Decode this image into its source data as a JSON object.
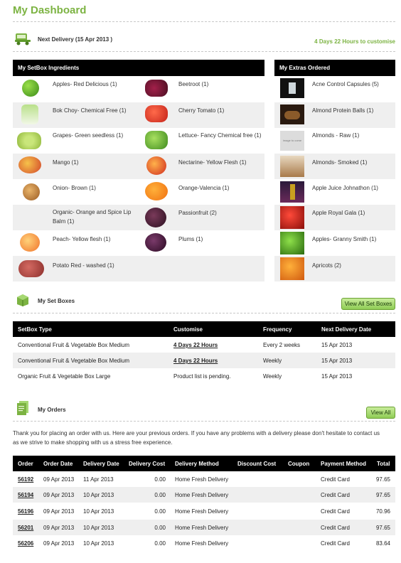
{
  "page": {
    "title": "My Dashboard"
  },
  "delivery": {
    "label": "Next Delivery (15 Apr 2013 )",
    "customise": "4 Days 22 Hours to customise"
  },
  "ingredients": {
    "header": "My SetBox Ingredients",
    "col1": [
      {
        "label": "Apples- Red Delicious (1)",
        "icon": "red-apple-icon"
      },
      {
        "label": "Bok Choy- Chemical Free (1)",
        "icon": "bok-choy-icon"
      },
      {
        "label": "Grapes- Green seedless (1)",
        "icon": "green-grapes-icon"
      },
      {
        "label": "Mango (1)",
        "icon": "mango-icon"
      },
      {
        "label": "Onion- Brown (1)",
        "icon": "onion-icon"
      },
      {
        "label": "Organic- Orange and Spice Lip Balm (1)",
        "icon": ""
      },
      {
        "label": "Peach- Yellow flesh (1)",
        "icon": "peach-icon"
      },
      {
        "label": "Potato Red - washed (1)",
        "icon": "red-potato-icon"
      }
    ],
    "col2": [
      {
        "label": "Beetroot (1)",
        "icon": "beetroot-icon"
      },
      {
        "label": "Cherry Tomato (1)",
        "icon": "cherry-tomato-icon"
      },
      {
        "label": "Lettuce- Fancy Chemical free (1)",
        "icon": "lettuce-icon"
      },
      {
        "label": "Nectarine- Yellow Flesh (1)",
        "icon": "nectarine-icon"
      },
      {
        "label": "Orange-Valencia (1)",
        "icon": "orange-icon"
      },
      {
        "label": "Passionfruit (2)",
        "icon": "passionfruit-icon"
      },
      {
        "label": "Plums (1)",
        "icon": "plum-icon"
      }
    ]
  },
  "extras": {
    "header": "My Extras Ordered",
    "items": [
      {
        "label": "Acne Control Capsules (5)",
        "icon": "capsules-icon"
      },
      {
        "label": "Almond Protein Balls (1)",
        "icon": "protein-balls-icon"
      },
      {
        "label": "Almonds - Raw (1)",
        "icon": "image-to-come-icon",
        "placeholder": "image to come"
      },
      {
        "label": "Almonds- Smoked (1)",
        "icon": "smoked-almonds-icon"
      },
      {
        "label": "Apple Juice Johnathon (1)",
        "icon": "apple-juice-icon"
      },
      {
        "label": "Apple Royal Gala (1)",
        "icon": "royal-gala-icon"
      },
      {
        "label": "Apples- Granny Smith (1)",
        "icon": "granny-smith-icon"
      },
      {
        "label": "Apricots (2)",
        "icon": "apricots-icon"
      }
    ]
  },
  "setboxes": {
    "label": "My Set Boxes",
    "view_all": "View All Set Boxes",
    "columns": [
      "SetBox Type",
      "Customise",
      "Frequency",
      "Next Delivery Date"
    ],
    "rows": [
      {
        "type": "Conventional Fruit & Vegetable Box Medium",
        "customise": "4 Days 22 Hours",
        "frequency": "Every 2 weeks",
        "date": "15 Apr 2013"
      },
      {
        "type": "Conventional Fruit & Vegetable Box Medium",
        "customise": "4 Days 22 Hours",
        "frequency": "Weekly",
        "date": "15 Apr 2013"
      },
      {
        "type": "Organic Fruit & Vegetable Box Large",
        "customise": "Product list is pending.",
        "frequency": "Weekly",
        "date": "15 Apr 2013"
      }
    ]
  },
  "orders": {
    "label": "My Orders",
    "view_all": "View All",
    "intro": "Thank you for placing an order with us. Here are your previous orders. If you have any problems with a delivery please don't hesitate to contact us as we strive to make shopping with us a stress free experience.",
    "columns": [
      "Order",
      "Order Date",
      "Delivery Date",
      "Delivery Cost",
      "Delivery Method",
      "Discount Cost",
      "Coupon",
      "Payment Method",
      "Total"
    ],
    "rows": [
      {
        "order": "56192",
        "order_date": "09 Apr 2013",
        "delivery_date": "11 Apr 2013",
        "cost": "0.00",
        "method": "Home Fresh Delivery",
        "discount": "",
        "coupon": "",
        "payment": "Credit Card",
        "total": "97.65"
      },
      {
        "order": "56194",
        "order_date": "09 Apr 2013",
        "delivery_date": "10 Apr 2013",
        "cost": "0.00",
        "method": "Home Fresh Delivery",
        "discount": "",
        "coupon": "",
        "payment": "Credit Card",
        "total": "97.65"
      },
      {
        "order": "56196",
        "order_date": "09 Apr 2013",
        "delivery_date": "10 Apr 2013",
        "cost": "0.00",
        "method": "Home Fresh Delivery",
        "discount": "",
        "coupon": "",
        "payment": "Credit Card",
        "total": "70.96"
      },
      {
        "order": "56201",
        "order_date": "09 Apr 2013",
        "delivery_date": "10 Apr 2013",
        "cost": "0.00",
        "method": "Home Fresh Delivery",
        "discount": "",
        "coupon": "",
        "payment": "Credit Card",
        "total": "97.65"
      },
      {
        "order": "56206",
        "order_date": "09 Apr 2013",
        "delivery_date": "10 Apr 2013",
        "cost": "0.00",
        "method": "Home Fresh Delivery",
        "discount": "",
        "coupon": "",
        "payment": "Credit Card",
        "total": "83.64"
      }
    ]
  },
  "colors": {
    "accent": "#7cb342",
    "header_bg": "#000000",
    "row_shade": "#efefef"
  }
}
